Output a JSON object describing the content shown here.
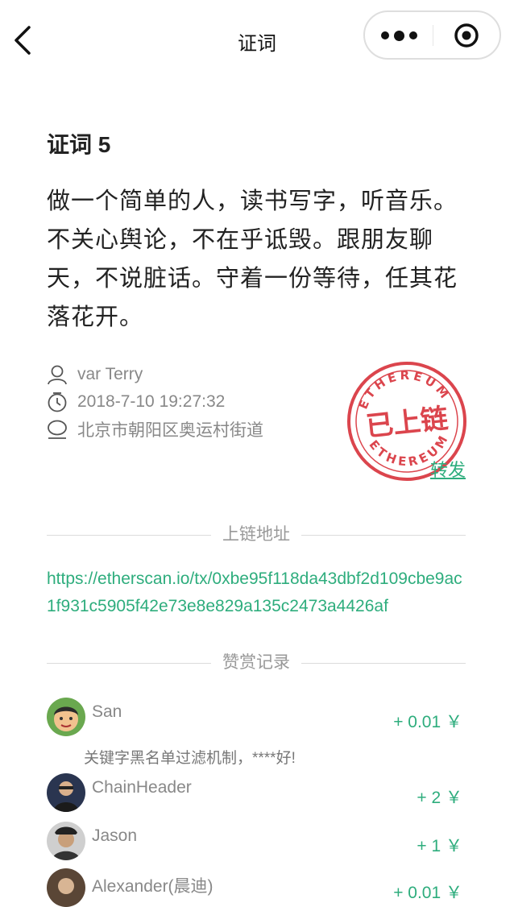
{
  "nav": {
    "title": "证词",
    "back_icon": "chevron-left-icon",
    "more_icon": "more-dots-icon",
    "close_icon": "target-close-icon"
  },
  "testimony": {
    "heading": "证词 5",
    "body": "做一个简单的人，读书写字，听音乐。不关心舆论，不在乎诋毁。跟朋友聊天，不说脏话。守着一份等待，任其花落花开。",
    "author": "var Terry",
    "datetime": "2018-7-10 19:27:32",
    "location": "北京市朝阳区奥运村街道"
  },
  "stamp": {
    "ring_text_top": "ETHEREUM",
    "ring_text_bottom": "ETHEREUM",
    "center_text": "已上链",
    "color": "#d9363e"
  },
  "share_label": "转发",
  "chain": {
    "section_label": "上链地址",
    "tx_url": "https://etherscan.io/tx/0xbe95f118da43dbf2d109cbe9ac1f931c5905f42e73e8e829a135c2473a4426af"
  },
  "rewards": {
    "section_label": "赞赏记录",
    "items": [
      {
        "name": "San",
        "amount": "+ 0.01 ￥",
        "note": "关键字黑名单过滤机制，****好!"
      },
      {
        "name": "ChainHeader",
        "amount": "+ 2 ￥"
      },
      {
        "name": "Jason",
        "amount": "+ 1 ￥"
      },
      {
        "name": "Alexander(晨迪)",
        "amount": "+ 0.01 ￥"
      }
    ]
  },
  "colors": {
    "accent": "#2ead7d",
    "stamp": "#d9363e",
    "muted": "#888888"
  }
}
